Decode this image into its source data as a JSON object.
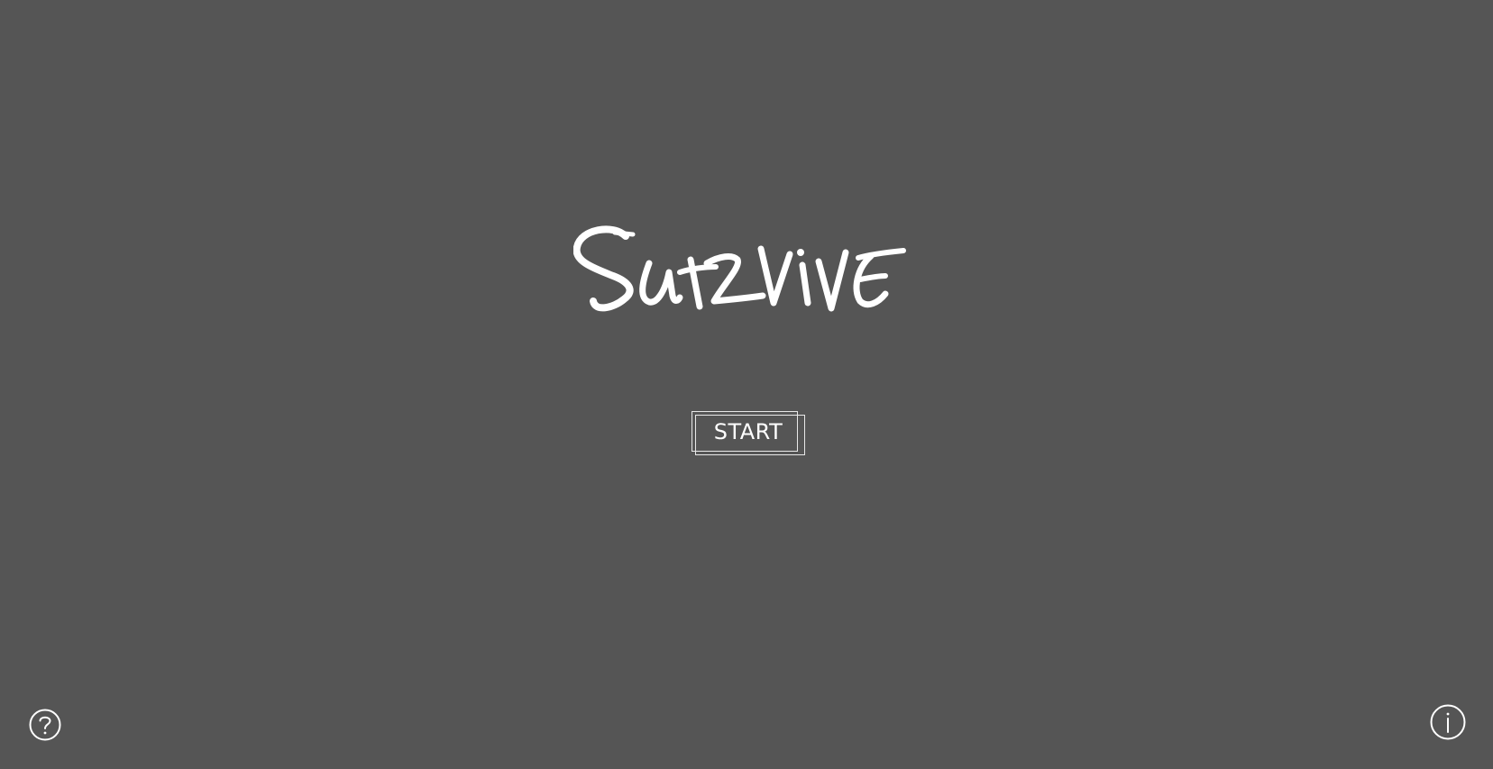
{
  "title": {
    "text": "Survive",
    "icon": "handwritten-logo"
  },
  "start_button": {
    "label": "START"
  },
  "corner_icons": {
    "help": "question-mark-icon",
    "info": "info-icon"
  },
  "colors": {
    "background": "#555555",
    "foreground": "#ffffff"
  }
}
